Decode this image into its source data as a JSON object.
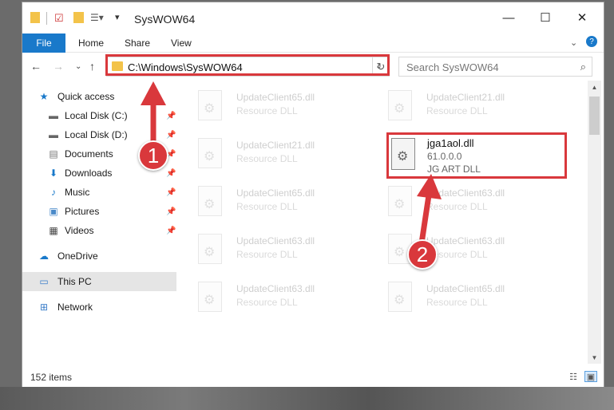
{
  "window": {
    "title": "SysWOW64"
  },
  "ribbon": {
    "tabs": [
      "File",
      "Home",
      "Share",
      "View"
    ]
  },
  "nav": {
    "address": "C:\\Windows\\SysWOW64",
    "search_placeholder": "Search SysWOW64"
  },
  "sidebar": {
    "items": [
      {
        "label": "Quick access",
        "icon": "star-icon",
        "pinned": false
      },
      {
        "label": "Local Disk (C:)",
        "icon": "drive-icon",
        "pinned": true
      },
      {
        "label": "Local Disk (D:)",
        "icon": "drive-icon",
        "pinned": true
      },
      {
        "label": "Documents",
        "icon": "documents-icon",
        "pinned": true
      },
      {
        "label": "Downloads",
        "icon": "download-icon",
        "pinned": true
      },
      {
        "label": "Music",
        "icon": "music-icon",
        "pinned": true
      },
      {
        "label": "Pictures",
        "icon": "pictures-icon",
        "pinned": true
      },
      {
        "label": "Videos",
        "icon": "videos-icon",
        "pinned": true
      },
      {
        "label": "OneDrive",
        "icon": "cloud-icon",
        "pinned": false
      },
      {
        "label": "This PC",
        "icon": "computer-icon",
        "pinned": false,
        "selected": true
      },
      {
        "label": "Network",
        "icon": "network-icon",
        "pinned": false
      }
    ]
  },
  "files": [
    {
      "name": "UpdateClient65.dll",
      "type": "Resource DLL"
    },
    {
      "name": "UpdateClient21.dll",
      "type": "Resource DLL"
    },
    {
      "name": "UpdateClient21.dll",
      "type": "Resource DLL"
    },
    {
      "name": "UpdateClient65.dll",
      "type": "Resource DLL"
    },
    {
      "name": "UpdateClient63.dll",
      "type": "Resource DLL"
    },
    {
      "name": "UpdateClient63.dll",
      "type": "Resource DLL"
    },
    {
      "name": "UpdateClient63.dll",
      "type": "Resource DLL"
    },
    {
      "name": "UpdateClient63.dll",
      "type": "Resource DLL"
    },
    {
      "name": "UpdateClient65.dll",
      "type": "Resource DLL"
    }
  ],
  "highlighted_file": {
    "name": "jga1aol.dll",
    "version": "61.0.0.0",
    "type": "JG ART DLL"
  },
  "status": {
    "item_count": "152 items"
  },
  "annotations": {
    "step1": "1",
    "step2": "2"
  }
}
